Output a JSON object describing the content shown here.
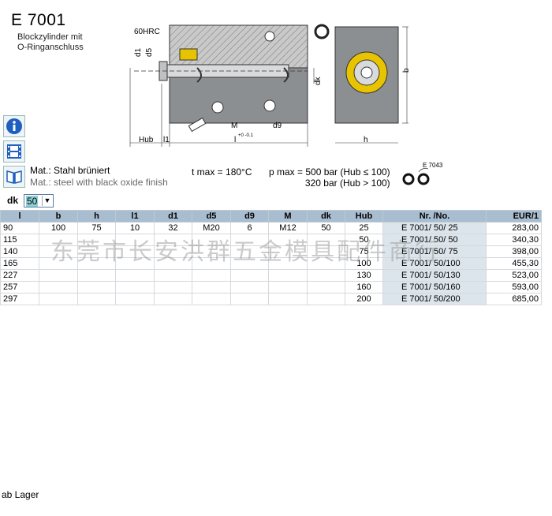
{
  "title": "E 7001",
  "subtitle_lines": [
    "Blockzylinder mit",
    "O-Ringanschluss"
  ],
  "drawing": {
    "hardness": "60HRC",
    "dim_d1": "d1",
    "dim_d5": "d5",
    "dim_dk": "dk",
    "dim_b": "b",
    "dim_M": "M",
    "dim_d9": "d9",
    "dim_hub": "Hub",
    "dim_l1": "l1",
    "dim_l": "l",
    "dim_tol": "+0 -0.1",
    "dim_h": "h"
  },
  "side_icons": [
    "info-icon",
    "film-icon",
    "book-icon"
  ],
  "material": {
    "de": "Mat.: Stahl brüniert",
    "en": "Mat.: steel with black oxide finish"
  },
  "t_max": "t max = 180°C",
  "p_max_lines": [
    "p max = 500 bar (Hub ≤ 100)",
    "320 bar (Hub > 100)"
  ],
  "oring_ref": "E 7043",
  "dk_filter": {
    "label": "dk",
    "value": "50"
  },
  "table": {
    "headers": [
      "l",
      "b",
      "h",
      "l1",
      "d1",
      "d5",
      "d9",
      "M",
      "dk",
      "Hub",
      "Nr. /No.",
      "EUR/1"
    ],
    "rows": [
      [
        "90",
        "100",
        "75",
        "10",
        "32",
        "M20",
        "6",
        "M12",
        "50",
        "25",
        "E 7001/  50/  25",
        "283,00"
      ],
      [
        "115",
        "",
        "",
        "",
        "",
        "",
        "",
        "",
        "",
        "50",
        "E 7001/  50/  50",
        "340,30"
      ],
      [
        "140",
        "",
        "",
        "",
        "",
        "",
        "",
        "",
        "",
        "75",
        "E 7001/  50/  75",
        "398,00"
      ],
      [
        "165",
        "",
        "",
        "",
        "",
        "",
        "",
        "",
        "",
        "100",
        "E 7001/  50/100",
        "455,30"
      ],
      [
        "227",
        "",
        "",
        "",
        "",
        "",
        "",
        "",
        "",
        "130",
        "E 7001/  50/130",
        "523,00"
      ],
      [
        "257",
        "",
        "",
        "",
        "",
        "",
        "",
        "",
        "",
        "160",
        "E 7001/  50/160",
        "593,00"
      ],
      [
        "297",
        "",
        "",
        "",
        "",
        "",
        "",
        "",
        "",
        "200",
        "E 7001/  50/200",
        "685,00"
      ]
    ]
  },
  "watermark": "东莞市长安洪群五金模具配件商行",
  "footer": "ab Lager"
}
